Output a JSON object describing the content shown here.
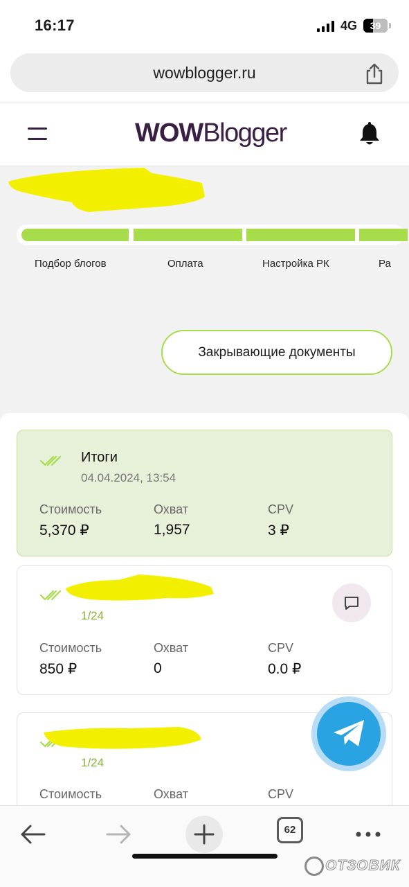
{
  "status_bar": {
    "time": "16:17",
    "network": "4G",
    "battery": "39"
  },
  "browser": {
    "url": "wowblogger.ru",
    "tabs_count": "62",
    "icons": {
      "share": "share-icon",
      "back": "arrow-left-icon",
      "forward": "arrow-right-icon",
      "new_tab": "plus-icon",
      "more": "more-dots-icon"
    }
  },
  "site_header": {
    "logo_bold": "WOW",
    "logo_regular": "Blogger",
    "icons": {
      "menu": "menu-icon",
      "notifications": "bell-icon"
    }
  },
  "campaign": {
    "title": "",
    "steps": [
      {
        "label": "Подбор блогов",
        "complete": true
      },
      {
        "label": "Оплата",
        "complete": true
      },
      {
        "label": "Настройка РК",
        "complete": true
      },
      {
        "label": "Ра",
        "complete": true
      }
    ],
    "documents_button": "Закрывающие документы"
  },
  "summary_card": {
    "title": "Итоги",
    "date": "04.04.2024, 13:54",
    "metrics": [
      {
        "label": "Стоимость",
        "value": "5,370 ₽"
      },
      {
        "label": "Охват",
        "value": "1,957"
      },
      {
        "label": "CPV",
        "value": "3 ₽"
      }
    ]
  },
  "placements": [
    {
      "name": "",
      "counter": "1/24",
      "metrics": [
        {
          "label": "Стоимость",
          "value": "850 ₽"
        },
        {
          "label": "Охват",
          "value": "0"
        },
        {
          "label": "CPV",
          "value": "0.0 ₽"
        }
      ]
    },
    {
      "name": "",
      "counter": "1/24",
      "metrics": [
        {
          "label": "Стоимость",
          "value": ""
        },
        {
          "label": "Охват",
          "value": ""
        },
        {
          "label": "CPV",
          "value": ""
        }
      ]
    }
  ],
  "colors": {
    "accent_green": "#a7dc4a",
    "summary_bg": "#e7f0d9",
    "brand_purple": "#3a1f45",
    "telegram_blue": "#2aa3e3",
    "redaction_yellow": "#f3ef00"
  },
  "watermark": "ОТЗОВИК"
}
